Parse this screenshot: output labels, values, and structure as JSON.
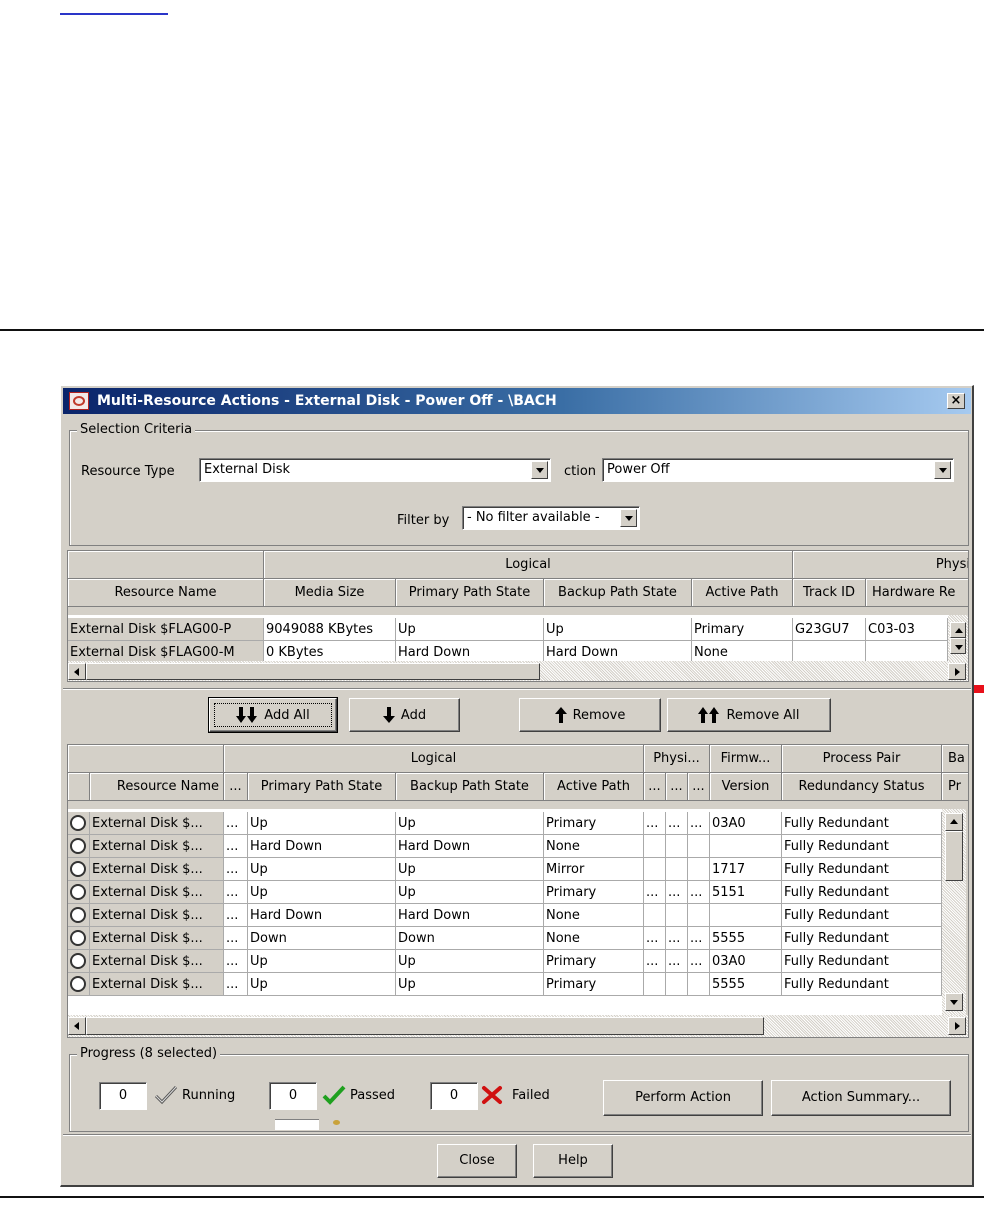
{
  "dialog": {
    "title": "Multi-Resource Actions - External Disk - Power Off - \\BACH",
    "close_glyph": "×",
    "selection": {
      "legend": "Selection Criteria",
      "resource_type_label": "Resource Type",
      "resource_type_value": "External Disk",
      "action_label": "ction",
      "action_value": "Power Off",
      "filter_label": "Filter by",
      "filter_value": "- No filter available -"
    },
    "top_table": {
      "group_headers": {
        "logical": "Logical",
        "physical": "Physi"
      },
      "columns": [
        "Resource Name",
        "Media Size",
        "Primary Path State",
        "Backup Path State",
        "Active Path",
        "Track ID",
        "Hardware Re"
      ],
      "rows": [
        [
          "External Disk $FLAG00-P",
          "9049088 KBytes",
          "Up",
          "Up",
          "Primary",
          "G23GU7",
          "C03-03"
        ],
        [
          "External Disk $FLAG00-M",
          "0 KBytes",
          "Hard Down",
          "Hard Down",
          "None",
          "",
          ""
        ]
      ]
    },
    "buttons": {
      "add_all": "Add All",
      "add": "Add",
      "remove": "Remove",
      "remove_all": "Remove All"
    },
    "bottom_table": {
      "group_headers": {
        "logical": "Logical",
        "physical": "Physi...",
        "firmware": "Firmw...",
        "process_pair": "Process Pair",
        "ba": "Ba"
      },
      "columns": [
        "Resource Name",
        "...",
        "Primary Path State",
        "Backup Path State",
        "Active Path",
        "...",
        "...",
        "...",
        "Version",
        "Redundancy Status",
        "Pr"
      ],
      "rows": [
        [
          "External Disk $...",
          "...",
          "Up",
          "Up",
          "Primary",
          "...",
          "...",
          "...",
          "03A0",
          "Fully Redundant"
        ],
        [
          "External Disk $...",
          "...",
          "Hard Down",
          "Hard Down",
          "None",
          "",
          "",
          "",
          "",
          "Fully Redundant"
        ],
        [
          "External Disk $...",
          "...",
          "Up",
          "Up",
          "Mirror",
          "",
          "",
          "",
          "1717",
          "Fully Redundant"
        ],
        [
          "External Disk $...",
          "...",
          "Up",
          "Up",
          "Primary",
          "...",
          "...",
          "...",
          "5151",
          "Fully Redundant"
        ],
        [
          "External Disk $...",
          "...",
          "Hard Down",
          "Hard Down",
          "None",
          "",
          "",
          "",
          "",
          "Fully Redundant"
        ],
        [
          "External Disk $...",
          "...",
          "Down",
          "Down",
          "None",
          "...",
          "...",
          "...",
          "5555",
          "Fully Redundant"
        ],
        [
          "External Disk $...",
          "...",
          "Up",
          "Up",
          "Primary",
          "...",
          "...",
          "...",
          "03A0",
          "Fully Redundant"
        ],
        [
          "External Disk $...",
          "...",
          "Up",
          "Up",
          "Primary",
          "",
          "",
          "",
          "5555",
          "Fully Redundant"
        ]
      ]
    },
    "progress": {
      "legend": "Progress (8 selected)",
      "running_count": "0",
      "running_label": "Running",
      "passed_count": "0",
      "passed_label": "Passed",
      "failed_count": "0",
      "failed_label": "Failed",
      "perform_action": "Perform Action",
      "action_summary": "Action Summary..."
    },
    "footer": {
      "close": "Close",
      "help": "Help"
    }
  },
  "colors": {
    "title_start": "#0a246a",
    "title_end": "#a6caf0",
    "arrow": "#e8101a",
    "passed_check": "#1fa01f",
    "failed_x": "#d01010",
    "link_underline": "#2a35c8"
  }
}
